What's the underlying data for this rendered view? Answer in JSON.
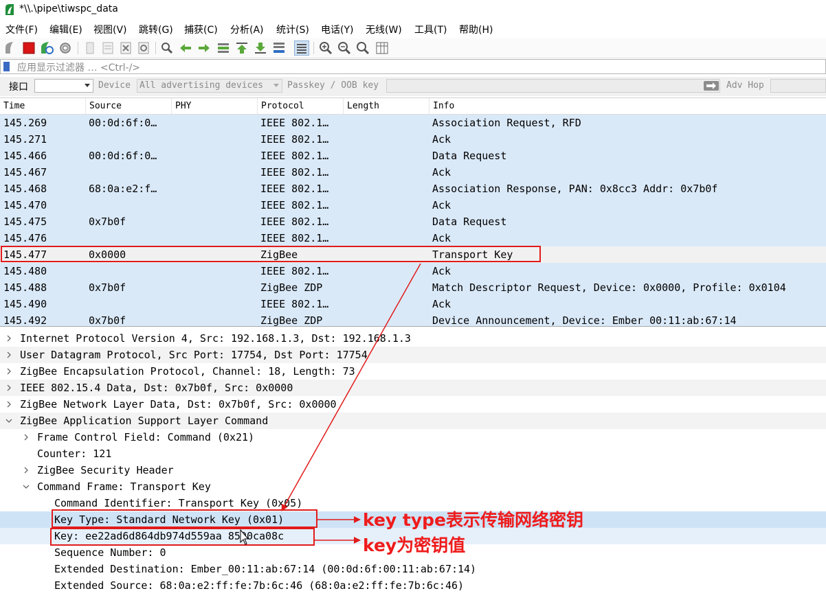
{
  "window": {
    "title": "*\\\\.\\pipe\\tiwspc_data"
  },
  "menu": [
    "文件(F)",
    "编辑(E)",
    "视图(V)",
    "跳转(G)",
    "捕获(C)",
    "分析(A)",
    "统计(S)",
    "电话(Y)",
    "无线(W)",
    "工具(T)",
    "帮助(H)"
  ],
  "filter": {
    "placeholder": "应用显示过滤器 … <Ctrl-/>"
  },
  "interface_bar": {
    "interface_label": "接口",
    "device_label": "Device",
    "device_value": "All advertising devices",
    "passkey_label": "Passkey / OOB key",
    "adv_hop_label": "Adv Hop"
  },
  "packet_list": {
    "columns": [
      "Time",
      "Source",
      "PHY",
      "Protocol",
      "Length",
      "Info"
    ],
    "rows": [
      {
        "time": "145.269",
        "source": "00:0d:6f:0…",
        "protocol": "IEEE 802.1…",
        "info": "Association Request, RFD"
      },
      {
        "time": "145.271",
        "source": "",
        "protocol": "IEEE 802.1…",
        "info": "Ack"
      },
      {
        "time": "145.466",
        "source": "00:0d:6f:0…",
        "protocol": "IEEE 802.1…",
        "info": "Data Request"
      },
      {
        "time": "145.467",
        "source": "",
        "protocol": "IEEE 802.1…",
        "info": "Ack"
      },
      {
        "time": "145.468",
        "source": "68:0a:e2:f…",
        "protocol": "IEEE 802.1…",
        "info": "Association Response, PAN: 0x8cc3 Addr: 0x7b0f"
      },
      {
        "time": "145.470",
        "source": "",
        "protocol": "IEEE 802.1…",
        "info": "Ack"
      },
      {
        "time": "145.475",
        "source": "0x7b0f",
        "protocol": "IEEE 802.1…",
        "info": "Data Request"
      },
      {
        "time": "145.476",
        "source": "",
        "protocol": "IEEE 802.1…",
        "info": "Ack"
      },
      {
        "time": "145.477",
        "source": "0x0000",
        "protocol": "ZigBee",
        "info": "Transport Key",
        "selected": true
      },
      {
        "time": "145.480",
        "source": "",
        "protocol": "IEEE 802.1…",
        "info": "Ack"
      },
      {
        "time": "145.488",
        "source": "0x7b0f",
        "protocol": "ZigBee ZDP",
        "info": "Match Descriptor Request, Device: 0x0000, Profile: 0x0104"
      },
      {
        "time": "145.490",
        "source": "",
        "protocol": "IEEE 802.1…",
        "info": "Ack"
      },
      {
        "time": "145.492",
        "source": "0x7b0f",
        "protocol": "ZigBee ZDP",
        "info": "Device Announcement, Device: Ember 00:11:ab:67:14"
      }
    ]
  },
  "details": [
    {
      "indent": 0,
      "twisty": "collapsed",
      "text": "Internet Protocol Version 4, Src: 192.168.1.3, Dst: 192.168.1.3"
    },
    {
      "indent": 0,
      "twisty": "collapsed",
      "text": "User Datagram Protocol, Src Port: 17754, Dst Port: 17754"
    },
    {
      "indent": 0,
      "twisty": "collapsed",
      "text": "ZigBee Encapsulation Protocol, Channel: 18, Length: 73"
    },
    {
      "indent": 0,
      "twisty": "collapsed",
      "text": "IEEE 802.15.4 Data, Dst: 0x7b0f, Src: 0x0000"
    },
    {
      "indent": 0,
      "twisty": "collapsed",
      "text": "ZigBee Network Layer Data, Dst: 0x7b0f, Src: 0x0000"
    },
    {
      "indent": 0,
      "twisty": "expanded",
      "text": "ZigBee Application Support Layer Command"
    },
    {
      "indent": 1,
      "twisty": "collapsed",
      "text": "Frame Control Field: Command (0x21)"
    },
    {
      "indent": 1,
      "twisty": "none",
      "text": "Counter: 121"
    },
    {
      "indent": 1,
      "twisty": "collapsed",
      "text": "ZigBee Security Header"
    },
    {
      "indent": 1,
      "twisty": "expanded",
      "text": "Command Frame: Transport Key"
    },
    {
      "indent": 2,
      "twisty": "none",
      "text": "Command Identifier: Transport Key (0x05)"
    },
    {
      "indent": 2,
      "twisty": "none",
      "text": "Key Type: Standard Network Key (0x01)",
      "highlight": "selected"
    },
    {
      "indent": 2,
      "twisty": "none",
      "text": "Key: ee22ad6d864db974d559aa 8590ca08c",
      "highlight": "hover"
    },
    {
      "indent": 2,
      "twisty": "none",
      "text": "Sequence Number: 0"
    },
    {
      "indent": 2,
      "twisty": "none",
      "text": "Extended Destination: Ember_00:11:ab:67:14 (00:0d:6f:00:11:ab:67:14)"
    },
    {
      "indent": 2,
      "twisty": "none",
      "text": "Extended Source: 68:0a:e2:ff:fe:7b:6c:46 (68:0a:e2:ff:fe:7b:6c:46)"
    }
  ],
  "annotations": {
    "key_type_note": "key type表示传输网络密钥",
    "key_note": "key为密钥值",
    "color": "#e11b1b"
  },
  "icons": [
    "wireshark-logo-icon",
    "shark-fin-start-icon",
    "stop-icon",
    "restart-icon",
    "options-gear-icon",
    "open-file-icon",
    "save-file-icon",
    "close-file-icon",
    "reload-icon",
    "find-icon",
    "back-icon",
    "forward-icon",
    "goto-packet-icon",
    "first-packet-icon",
    "last-packet-icon",
    "autoscroll-icon",
    "colorize-icon",
    "zoom-in-icon",
    "zoom-out-icon",
    "zoom-normal-icon",
    "resize-columns-icon",
    "bookmark-icon",
    "apply-arrow-icon",
    "twisty-icon",
    "mouse-cursor-icon"
  ]
}
